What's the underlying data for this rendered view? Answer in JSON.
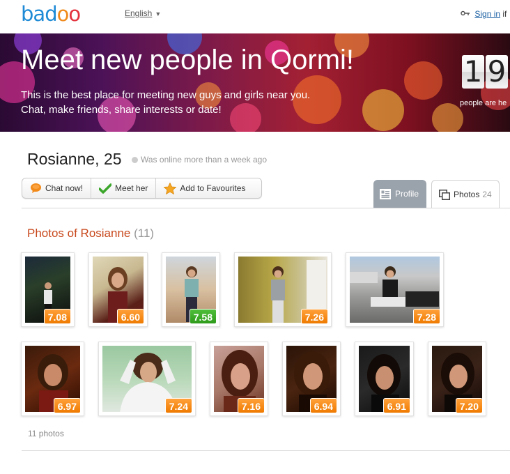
{
  "header": {
    "logo": "badoo",
    "language": "English",
    "sign_in_label": "Sign in",
    "sign_in_suffix": "if"
  },
  "banner": {
    "title": "Meet new people in Qormi!",
    "subtitle_line1": "This is the best place for meeting new guys and girls near you.",
    "subtitle_line2": "Chat, make friends, share interests or date!",
    "counter_digits": [
      "1",
      "9"
    ],
    "counter_label": "people are he"
  },
  "profile": {
    "name": "Rosianne, 25",
    "online_status": "Was online more than a week ago",
    "actions": {
      "chat": "Chat now!",
      "meet": "Meet her",
      "favourite": "Add to Favourites"
    },
    "tabs": {
      "profile": "Profile",
      "photos": "Photos",
      "photos_count": "24"
    }
  },
  "photos": {
    "title": "Photos of Rosianne",
    "title_count": "(11)",
    "ratings": [
      "7.08",
      "6.60",
      "7.58",
      "7.26",
      "7.28",
      "6.97",
      "7.24",
      "7.16",
      "6.94",
      "6.91",
      "7.20"
    ],
    "footer": "11 photos"
  },
  "colors": {
    "accent_orange": "#ef7a00",
    "rating_green": "#2e9a1b",
    "title_red": "#c8481c",
    "link_blue": "#1a5fa3"
  }
}
